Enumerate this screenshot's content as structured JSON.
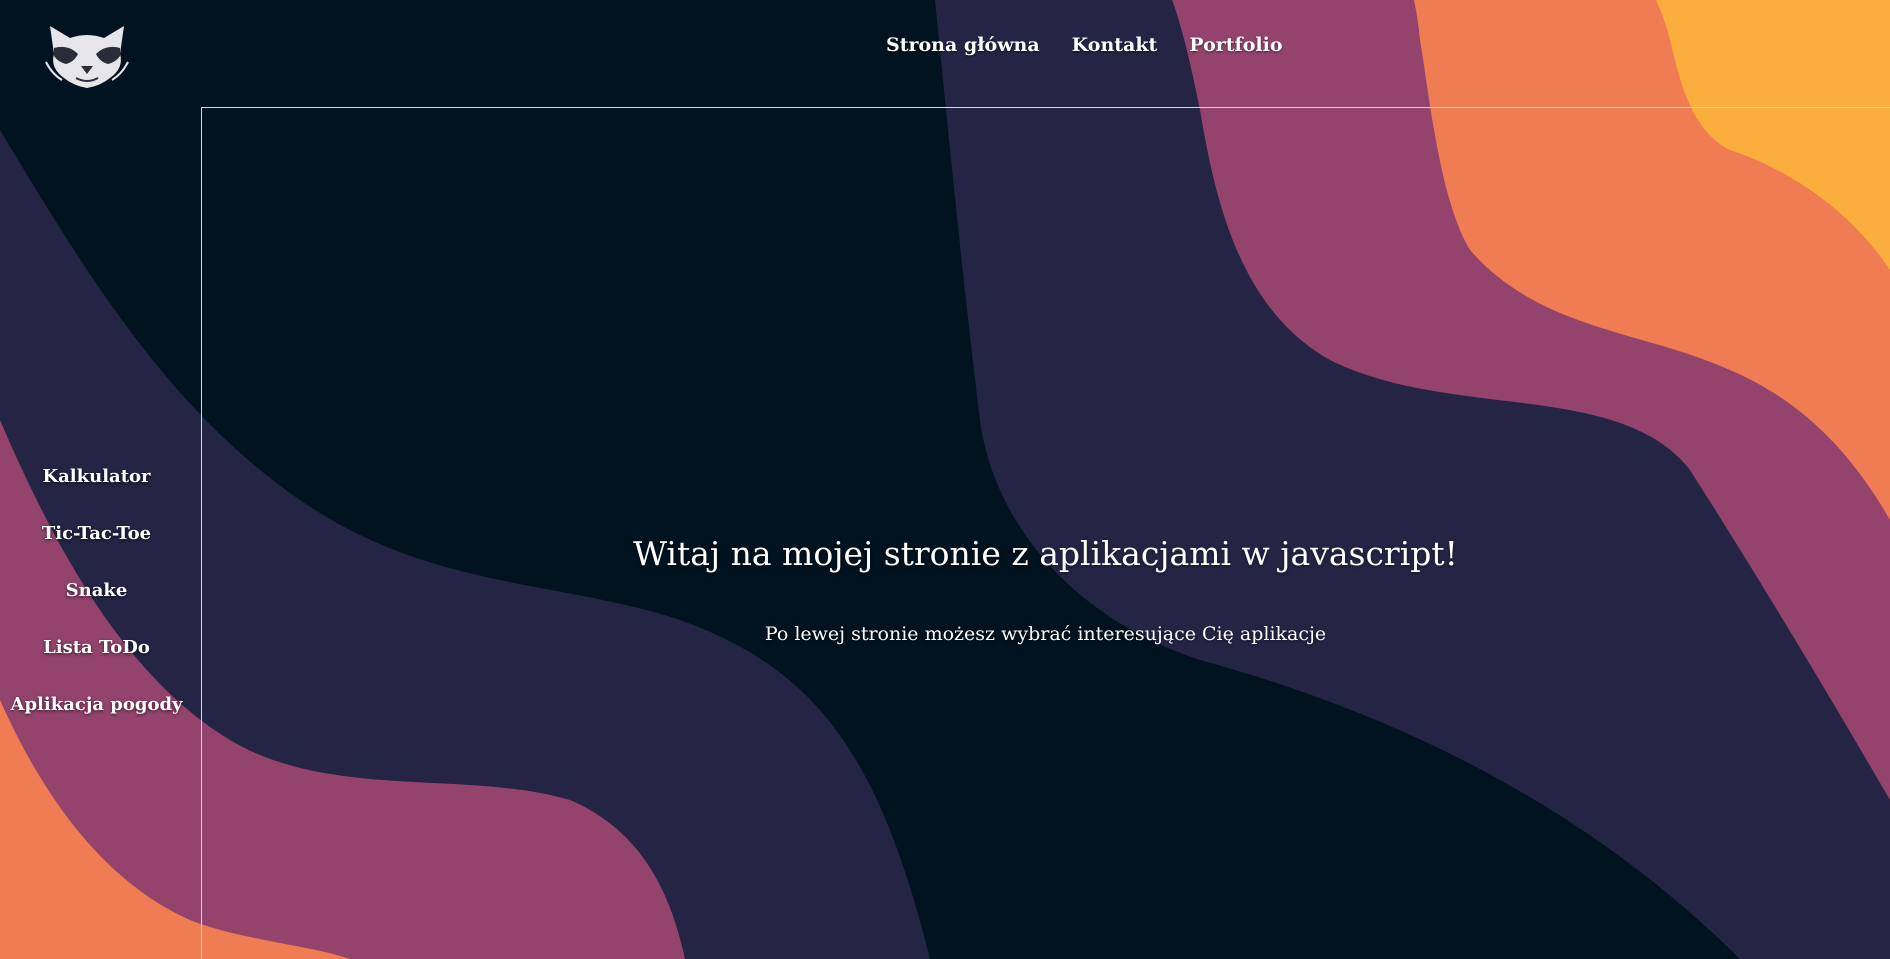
{
  "colors": {
    "background": "#011220",
    "wave_navy": "#242545",
    "wave_plum": "#94446c",
    "wave_orange": "#ef7c53",
    "wave_yellow": "#fbad3e",
    "text": "#ffffff"
  },
  "logo": {
    "icon": "raccoon-logo-icon"
  },
  "top_nav": {
    "items": [
      {
        "label": "Strona główna"
      },
      {
        "label": "Kontakt"
      },
      {
        "label": "Portfolio"
      }
    ]
  },
  "side_nav": {
    "items": [
      {
        "label": "Kalkulator"
      },
      {
        "label": "Tic-Tac-Toe"
      },
      {
        "label": "Snake"
      },
      {
        "label": "Lista ToDo"
      },
      {
        "label": "Aplikacja pogody"
      }
    ]
  },
  "main": {
    "heading": "Witaj na mojej stronie z aplikacjami w javascript!",
    "subtext": "Po lewej stronie możesz wybrać interesujące Cię aplikacje"
  }
}
